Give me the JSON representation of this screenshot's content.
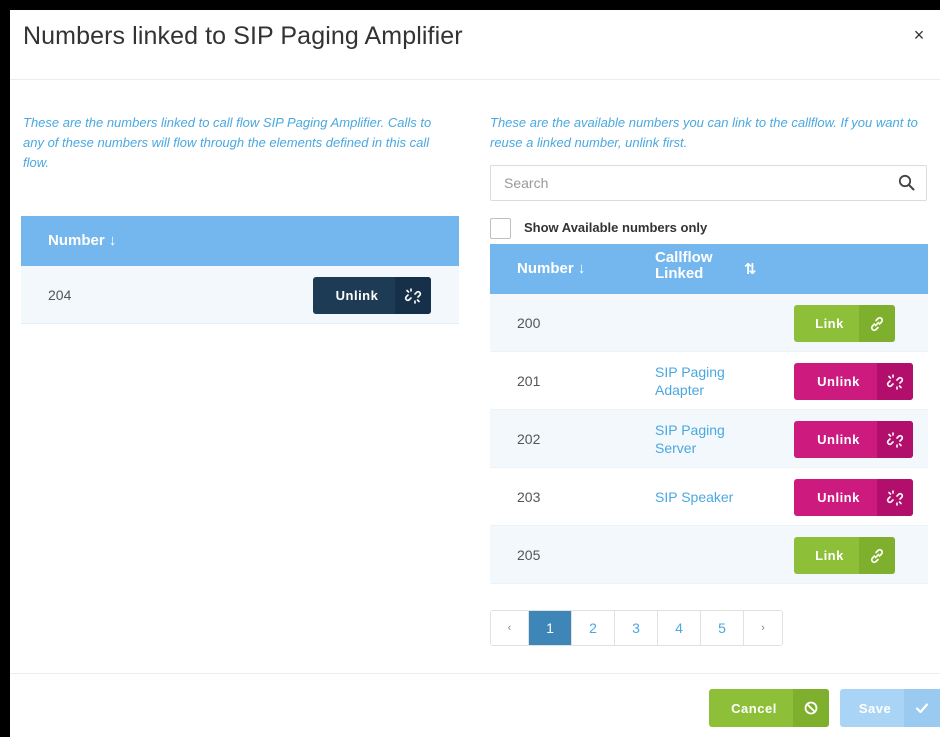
{
  "modal": {
    "title": "Numbers linked to SIP Paging Amplifier",
    "close_glyph": "×"
  },
  "left": {
    "description": "These are the numbers linked to call flow SIP Paging Amplifier. Calls to any of these numbers will flow through the elements defined in this call flow.",
    "header_number": "Number ↓",
    "rows": [
      {
        "number": "204",
        "action": "Unlink",
        "icon": "unlink-icon"
      }
    ]
  },
  "right": {
    "description": "These are the available numbers you can link to the callflow. If you want to reuse a linked number, unlink first.",
    "search": {
      "placeholder": "Search",
      "value": ""
    },
    "show_available_label": "Show Available numbers only",
    "header_number": "Number ↓",
    "header_callflow": "Callflow Linked",
    "header_sort_glyph": "⇅",
    "rows": [
      {
        "number": "200",
        "callflow": "",
        "action": "Link"
      },
      {
        "number": "201",
        "callflow": "SIP Paging Adapter",
        "action": "Unlink"
      },
      {
        "number": "202",
        "callflow": "SIP Paging Server",
        "action": "Unlink"
      },
      {
        "number": "203",
        "callflow": "SIP Speaker",
        "action": "Unlink"
      },
      {
        "number": "205",
        "callflow": "",
        "action": "Link"
      }
    ]
  },
  "pagination": {
    "prev": "‹",
    "pages": [
      "1",
      "2",
      "3",
      "4",
      "5"
    ],
    "current": "1",
    "next": "›"
  },
  "footer": {
    "cancel_label": "Cancel",
    "save_label": "Save"
  },
  "colors": {
    "header_blue": "#74b7ee",
    "link_green": "#8dc038",
    "unlink_magenta": "#cc1a7e",
    "unlink_dark": "#1e3b55",
    "save_disabled": "#a9d4f5",
    "accent_text": "#4aa8e0"
  }
}
